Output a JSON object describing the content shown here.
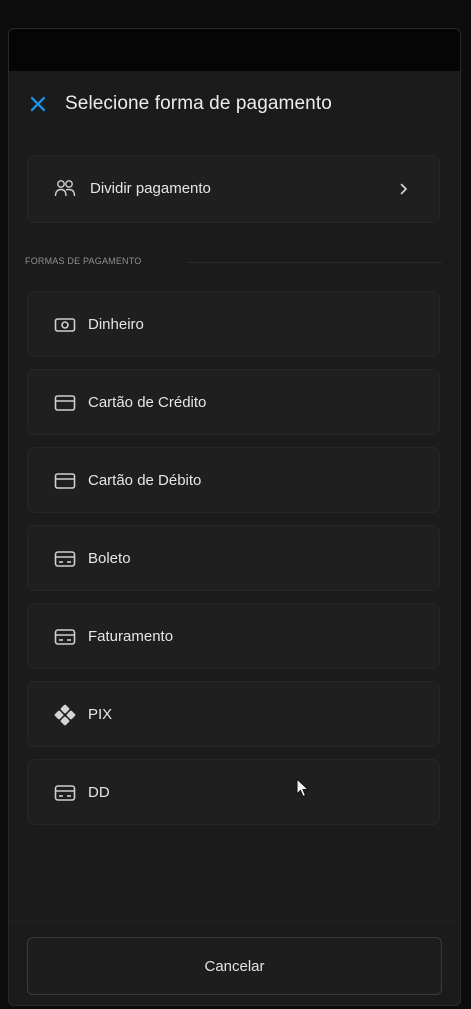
{
  "dialog": {
    "title": "Selecione forma de pagamento",
    "close_icon": "close-icon",
    "accent_color": "#1a8fe0"
  },
  "split_payment": {
    "label": "Dividir pagamento",
    "icon": "users-icon",
    "chevron": ">"
  },
  "section": {
    "title": "FORMAS DE PAGAMENTO"
  },
  "payment_methods": [
    {
      "label": "Dinheiro",
      "icon": "cash-icon"
    },
    {
      "label": "Cartão de Crédito",
      "icon": "credit-card-icon"
    },
    {
      "label": "Cartão de Débito",
      "icon": "debit-card-icon"
    },
    {
      "label": "Boleto",
      "icon": "boleto-icon"
    },
    {
      "label": "Faturamento",
      "icon": "invoice-icon"
    },
    {
      "label": "PIX",
      "icon": "pix-icon"
    },
    {
      "label": "DD",
      "icon": "card-icon"
    }
  ],
  "footer": {
    "cancel_label": "Cancelar"
  }
}
